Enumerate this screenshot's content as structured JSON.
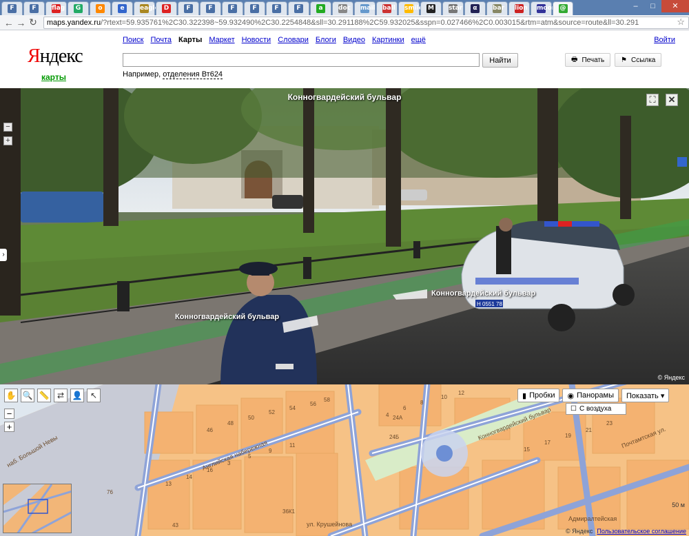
{
  "browser": {
    "tabs": [
      {
        "icon": "F",
        "color": "#4a6fa5"
      },
      {
        "icon": "F",
        "color": "#4a6fa5"
      },
      {
        "icon": "flag",
        "color": "#d22"
      },
      {
        "icon": "G",
        "color": "#2a6"
      },
      {
        "icon": "o",
        "color": "#f80"
      },
      {
        "icon": "e",
        "color": "#36c"
      },
      {
        "icon": "eagle",
        "color": "#a82"
      },
      {
        "icon": "D",
        "color": "#d22"
      },
      {
        "icon": "F",
        "color": "#4a6fa5"
      },
      {
        "icon": "F",
        "color": "#4a6fa5"
      },
      {
        "icon": "F",
        "color": "#4a6fa5"
      },
      {
        "icon": "F",
        "color": "#4a6fa5"
      },
      {
        "icon": "F",
        "color": "#4a6fa5"
      },
      {
        "icon": "F",
        "color": "#4a6fa5"
      },
      {
        "icon": "a",
        "color": "#2a2"
      },
      {
        "icon": "doc",
        "color": "#888"
      },
      {
        "icon": "mail",
        "color": "#69c"
      },
      {
        "icon": "ball",
        "color": "#c33"
      },
      {
        "icon": "smile",
        "color": "#fb0"
      },
      {
        "icon": "M",
        "color": "#222"
      },
      {
        "icon": "star",
        "color": "#777"
      },
      {
        "icon": "α",
        "color": "#225"
      },
      {
        "icon": "bar",
        "color": "#886"
      },
      {
        "icon": "lion",
        "color": "#c22"
      },
      {
        "icon": "moon",
        "color": "#339"
      },
      {
        "icon": "@",
        "color": "#3a3",
        "active": true
      }
    ],
    "url_host": "maps.yandex.ru",
    "url_rest": "/?rtext=59.935761%2C30.322398~59.932490%2C30.2254848&sll=30.291188%2C59.932025&sspn=0.027466%2C0.003015&rtm=atm&source=route&ll=30.291"
  },
  "header": {
    "logo_ya": "Я",
    "logo_rest": "ндекс",
    "sublogo": "карты",
    "services": [
      "Поиск",
      "Почта",
      "Карты",
      "Маркет",
      "Новости",
      "Словари",
      "Блоги",
      "Видео",
      "Картинки",
      "ещё"
    ],
    "current_service": "Карты",
    "login": "Войти",
    "search_value": "",
    "find_label": "Найти",
    "example_prefix": "Например, ",
    "example_link": "отделения Вт624",
    "print_label": "Печать",
    "link_label": "Ссылка"
  },
  "panorama": {
    "title": "Конногвардейский бульвар",
    "label_right": "Конногвардейский бульвар",
    "label_left": "Конногвардейский бульвар",
    "copyright": "© Яндекс",
    "car_plate": "Н 0551 78"
  },
  "map": {
    "layers": {
      "traffic": "Пробки",
      "panoramas": "Панорамы",
      "show": "Показать ▾",
      "aerial": "С воздуха"
    },
    "streets": [
      "Английская набережная",
      "Конногвардейский бульвар",
      "Почтамтская ул.",
      "наб. Большой Невы",
      "Адмиралтейская",
      "ул. Крушейнова"
    ],
    "house_numbers": [
      "46",
      "48",
      "50",
      "52",
      "54",
      "56",
      "58",
      "4",
      "6",
      "8",
      "10",
      "12",
      "24А",
      "24Б",
      "15",
      "17",
      "19",
      "21",
      "23",
      "13",
      "14",
      "16",
      "3",
      "5",
      "9",
      "11",
      "76",
      "36К1",
      "43"
    ],
    "scale": "50 м",
    "footer_copy": "© Яндекс",
    "footer_link": "Пользовательское соглашение"
  }
}
